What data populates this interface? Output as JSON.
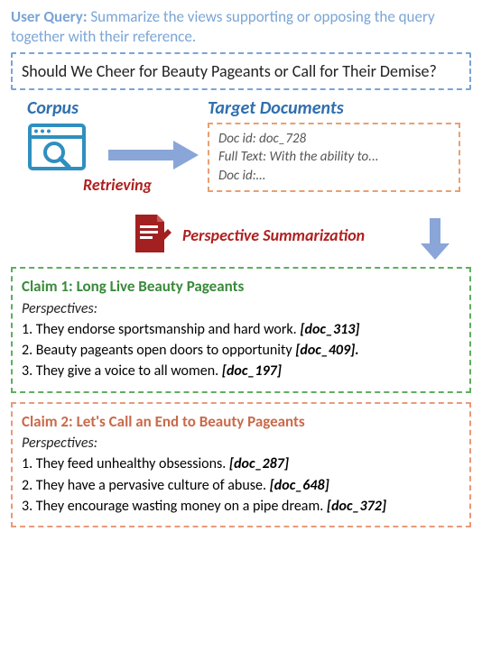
{
  "user_query": {
    "label": "User Query:",
    "text": "Summarize the views supporting or opposing the query together with their reference."
  },
  "question": "Should We Cheer for Beauty Pageants or Call for Their Demise?",
  "pipeline": {
    "corpus_label": "Corpus",
    "targets_label": "Target Documents",
    "retrieving_label": "Retrieving",
    "summarization_label": "Perspective Summarization",
    "targets": {
      "line1": "Doc id: doc_728",
      "line2": "Full Text: With the ability to...",
      "line3": "Doc id:…"
    }
  },
  "claims": [
    {
      "title": "Claim 1: Long Live Beauty Pageants",
      "persp_label": "Perspectives:",
      "items": [
        {
          "text": "1. They endorse sportsmanship and hard work.",
          "ref": "[doc_313]"
        },
        {
          "text": "2. Beauty pageants open doors to opportunity",
          "ref": "[doc_409]."
        },
        {
          "text": "3. They give a voice to all women.",
          "ref": "[doc_197]"
        }
      ]
    },
    {
      "title": "Claim 2: Let's Call an End to Beauty Pageants",
      "persp_label": "Perspectives:",
      "items": [
        {
          "text": "1. They feed unhealthy obsessions.",
          "ref": "[doc_287]"
        },
        {
          "text": "2. They have a pervasive culture of abuse.",
          "ref": "[doc_648]"
        },
        {
          "text": "3. They encourage wasting money on a pipe dream.",
          "ref": "[doc_372]"
        }
      ]
    }
  ]
}
